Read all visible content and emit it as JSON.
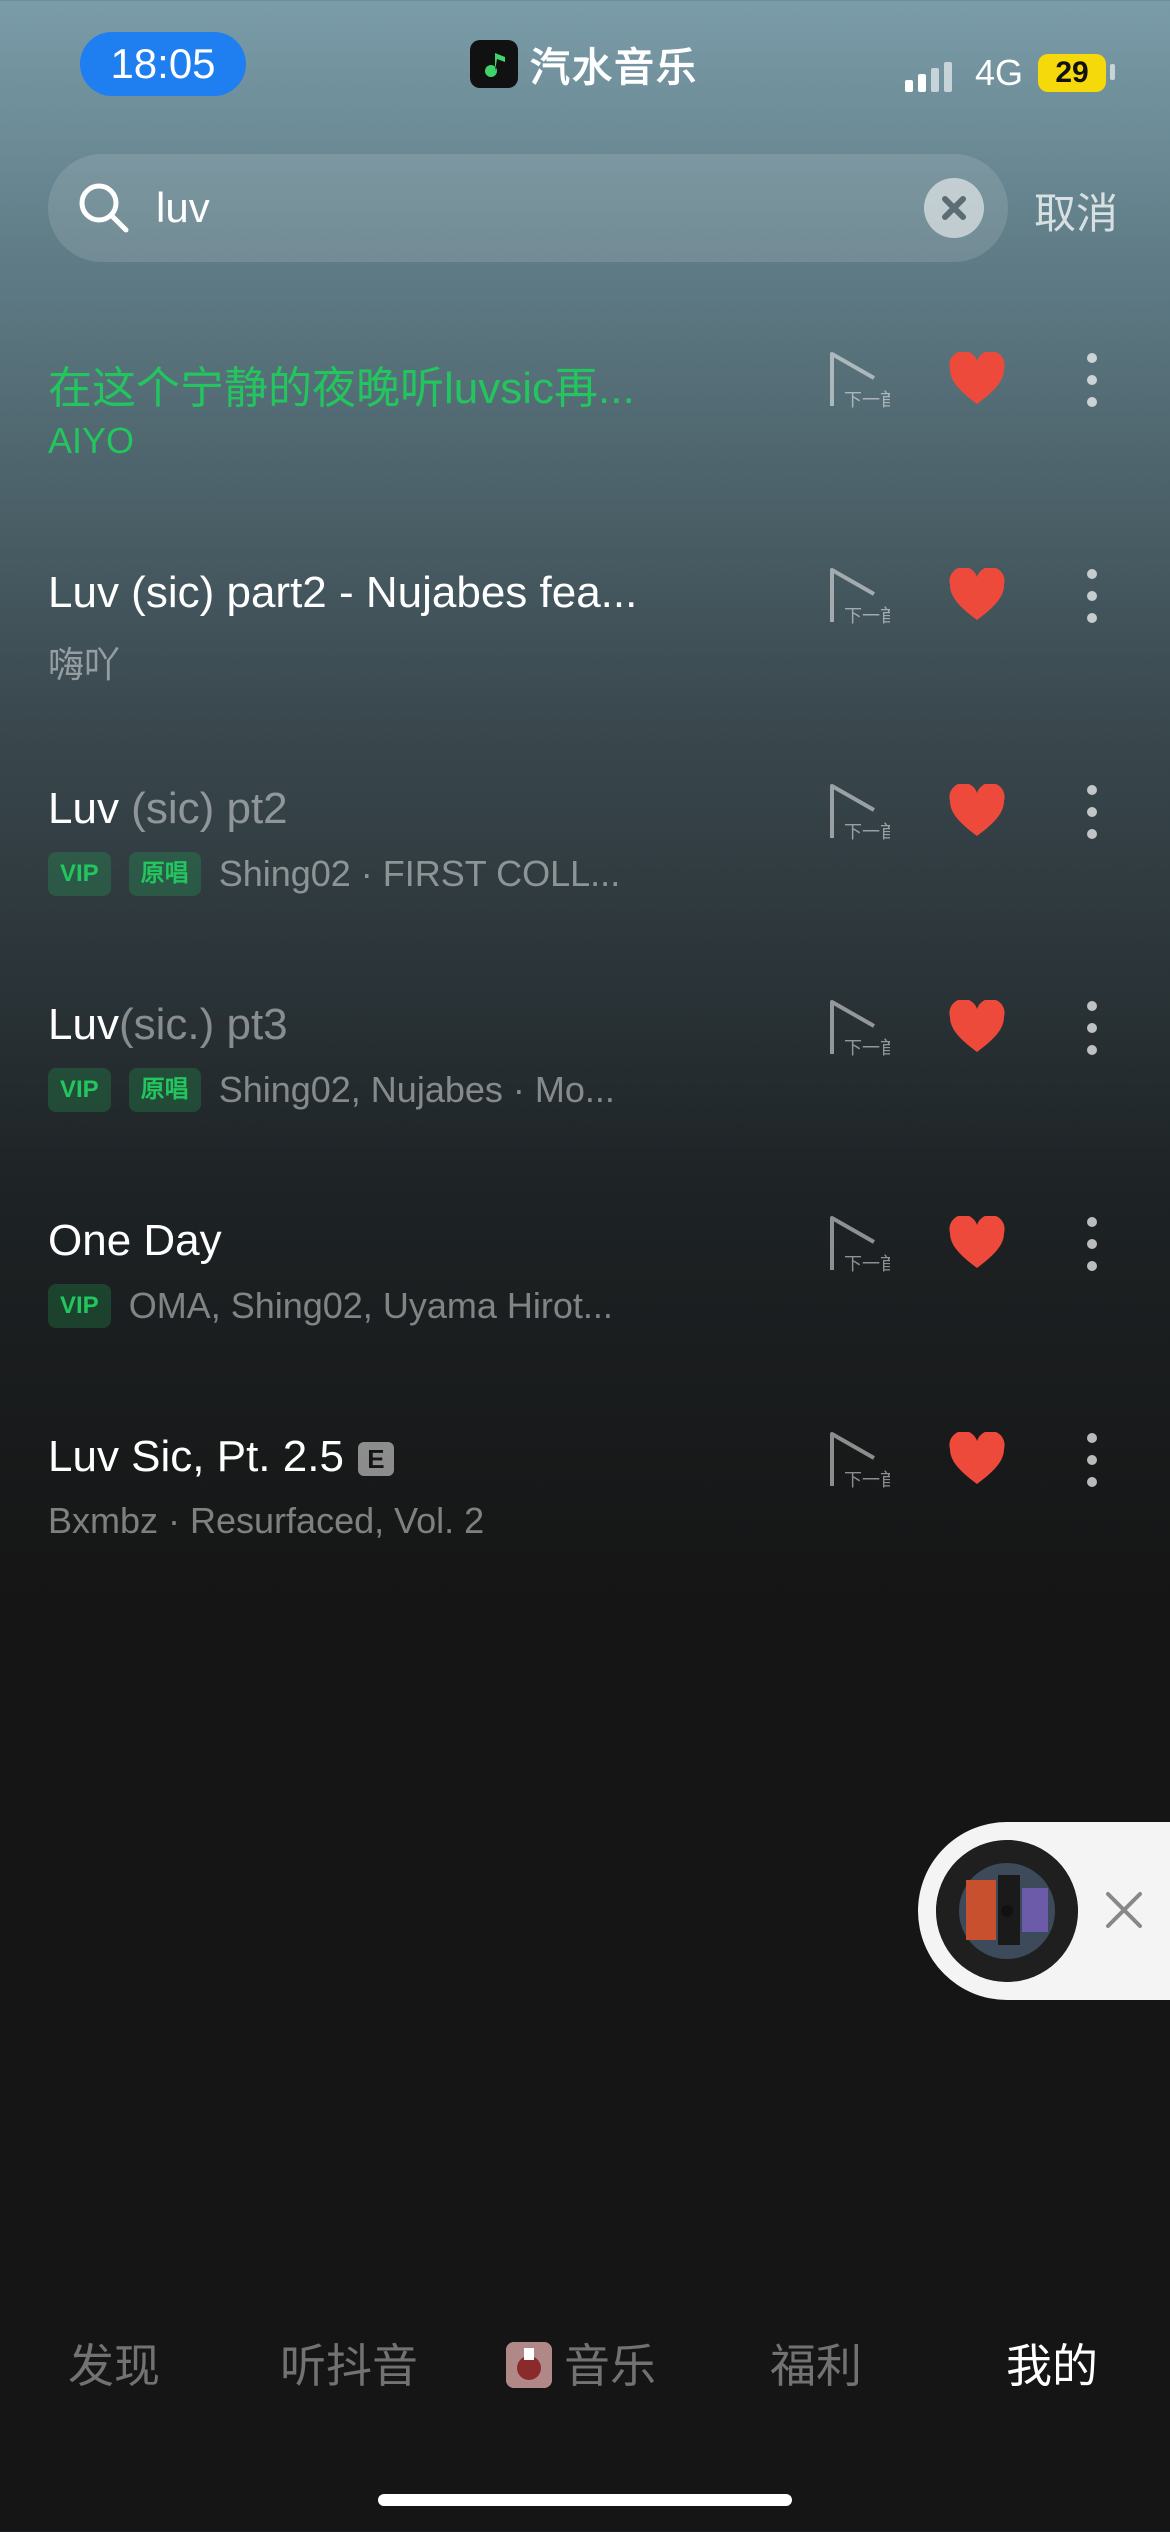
{
  "status_bar": {
    "time": "18:05",
    "app_name": "汽水音乐",
    "network": "4G",
    "battery": "29"
  },
  "search": {
    "query": "luv",
    "cancel_label": "取消"
  },
  "results": [
    {
      "title": "在这个宁静的夜晚听luvsic再...",
      "subtitle": "AIYO",
      "active": true
    },
    {
      "title": "Luv (sic) part2 - Nujabes fea...",
      "subtitle": "嗨吖"
    },
    {
      "title_main": "Luv",
      "title_dim": " (sic) pt2",
      "vip": "VIP",
      "original": "原唱",
      "subtitle": "Shing02 · FIRST COLL..."
    },
    {
      "title_main": "Luv",
      "title_dim": "(sic.) pt3",
      "vip": "VIP",
      "original": "原唱",
      "subtitle": "Shing02, Nujabes · Mo..."
    },
    {
      "title": "One Day",
      "vip": "VIP",
      "subtitle": "OMA, Shing02, Uyama Hirot..."
    },
    {
      "title": "Luv Sic, Pt. 2.5",
      "explicit": "E",
      "subtitle": "Bxmbz · Resurfaced, Vol. 2"
    }
  ],
  "icons": {
    "next": "play-next-icon",
    "next_label": "下一首",
    "like": "heart-icon",
    "more": "more-vertical-icon",
    "heart_color": "#ee4a3c",
    "accent": "#22c55e"
  },
  "tabs": [
    {
      "label": "发现"
    },
    {
      "label": "听抖音"
    },
    {
      "label": "音乐"
    },
    {
      "label": "福利"
    },
    {
      "label": "我的",
      "selected": true
    }
  ]
}
